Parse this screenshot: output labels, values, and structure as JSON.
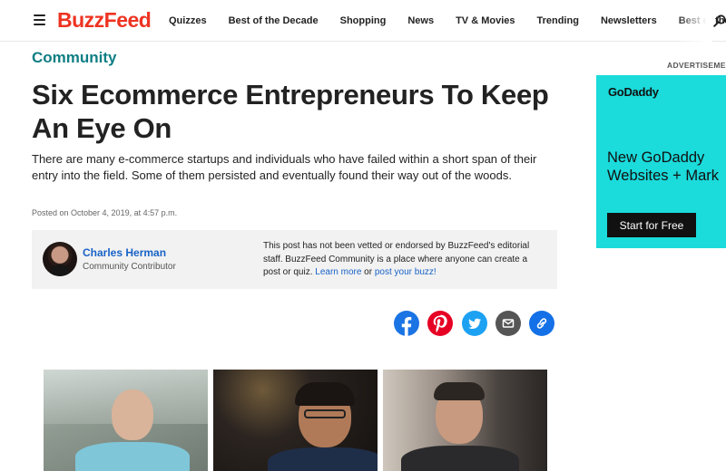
{
  "nav": {
    "logo": "BuzzFeed",
    "links": [
      "Quizzes",
      "Best of the Decade",
      "Shopping",
      "News",
      "TV & Movies",
      "Trending",
      "Newsletters",
      "Best of the W"
    ]
  },
  "article": {
    "category": "Community",
    "title": "Six Ecommerce Entrepreneurs To Keep An Eye On",
    "dek": "There are many e-commerce startups and individuals who have failed within a short span of their entry into the field. Some of them persisted and eventually found their way out of the woods.",
    "posted": "Posted on October 4, 2019, at 4:57 p.m."
  },
  "author": {
    "name": "Charles Herman",
    "role": "Community Contributor"
  },
  "disclaimer": {
    "text": "This post has not been vetted or endorsed by BuzzFeed's editorial staff. BuzzFeed Community is a place where anyone can create a post or quiz. ",
    "learn_more": "Learn more",
    "or": " or ",
    "post_buzz": "post your buzz!"
  },
  "share": [
    {
      "name": "facebook",
      "color": "#1b74e4"
    },
    {
      "name": "pinterest",
      "color": "#e60023"
    },
    {
      "name": "twitter",
      "color": "#1da1f2"
    },
    {
      "name": "email",
      "color": "#555555"
    },
    {
      "name": "link",
      "color": "#1470e6"
    }
  ],
  "ad": {
    "label": "ADVERTISEMENT",
    "brand": "GoDaddy",
    "headline_line1": "New GoDaddy",
    "headline_line2": "Websites + Mark",
    "cta": "Start for Free",
    "background": "#1bdbdb"
  },
  "colors": {
    "brand_red": "#e32222",
    "community_teal": "#0f7e84",
    "link_blue": "#1963c7"
  }
}
